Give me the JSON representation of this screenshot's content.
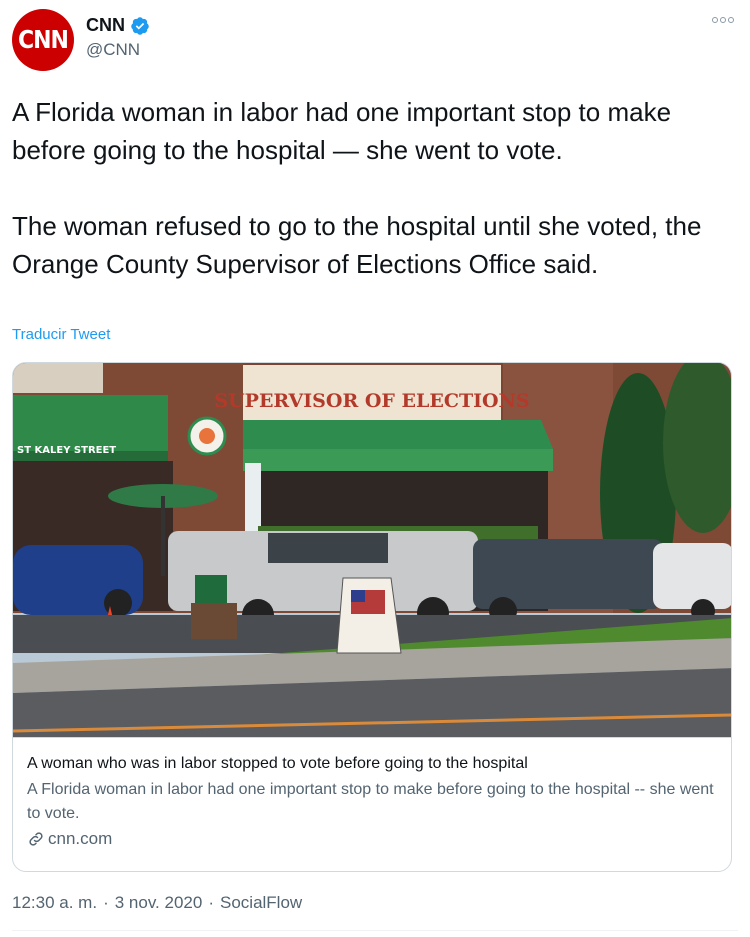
{
  "author": {
    "display_name": "CNN",
    "handle": "@CNN",
    "avatar_text": "CNN",
    "verified": true
  },
  "tweet": {
    "paragraphs": [
      "A Florida woman in labor had one important stop to make before going to the hospital — she went to vote.",
      "The woman refused to go to the hospital until she voted, the Orange County Supervisor of Elections Office said."
    ],
    "translate_label": "Traducir Tweet"
  },
  "card": {
    "image_sign_text": "SUPERVISOR OF ELECTIONS",
    "street_sign_text": "ST KALEY STREET",
    "title": "A woman who was in labor stopped to vote before going to the hospital",
    "description": "A Florida woman in labor had one important stop to make before going to the hospital -- she went to vote.",
    "domain": "cnn.com"
  },
  "meta": {
    "time": "12:30 a. m.",
    "separator": "·",
    "date": "3 nov. 2020",
    "source": "SocialFlow"
  },
  "colors": {
    "accent": "#1d9bf0",
    "brand": "#cc0000",
    "secondary_text": "#536471"
  }
}
